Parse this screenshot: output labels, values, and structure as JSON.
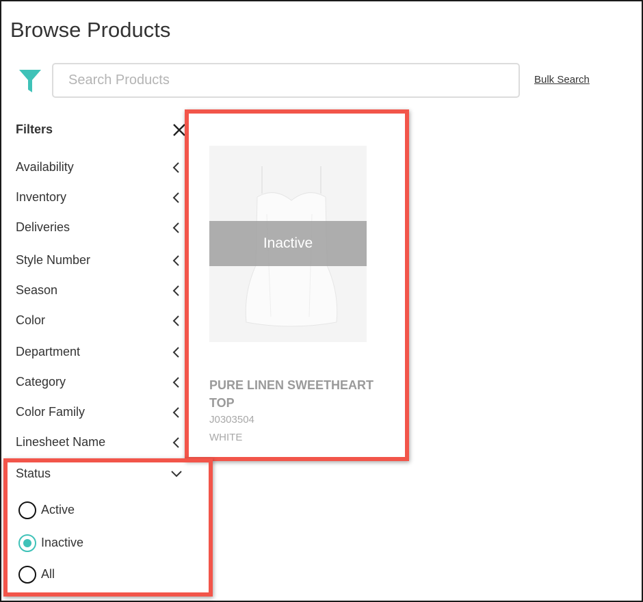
{
  "header": {
    "title": "Browse Products"
  },
  "search": {
    "placeholder": "Search Products",
    "value": ""
  },
  "bulk_search_label": "Bulk Search",
  "filters": {
    "title": "Filters",
    "items": [
      {
        "label": "Availability"
      },
      {
        "label": "Inventory"
      },
      {
        "label": "Deliveries"
      },
      {
        "label": "Style Number"
      },
      {
        "label": "Season"
      },
      {
        "label": "Color"
      },
      {
        "label": "Department"
      },
      {
        "label": "Category"
      },
      {
        "label": "Color Family"
      },
      {
        "label": "Linesheet Name"
      }
    ],
    "status": {
      "label": "Status",
      "expanded": true,
      "options": [
        {
          "label": "Active",
          "selected": false
        },
        {
          "label": "Inactive",
          "selected": true
        },
        {
          "label": "All",
          "selected": false
        }
      ]
    }
  },
  "product": {
    "status_overlay": "Inactive",
    "name": "PURE LINEN SWEETHEART TOP",
    "style_number": "J0303504",
    "color": "WHITE"
  },
  "colors": {
    "accent": "#3fc2b8",
    "highlight": "#f2554a",
    "text": "#333333",
    "muted": "#9a9a9a"
  },
  "icons": {
    "filter": "funnel-icon",
    "close": "close-icon",
    "collapsed": "chevron-left-icon",
    "expanded": "chevron-down-icon"
  }
}
